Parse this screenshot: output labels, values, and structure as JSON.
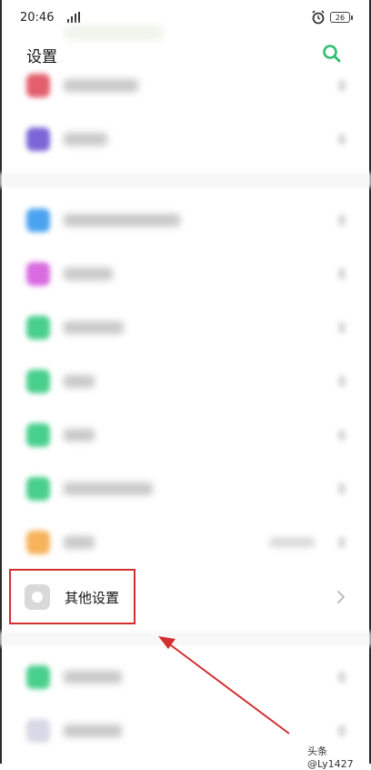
{
  "status_bar": {
    "time": "20:46",
    "battery": "26",
    "icons": [
      "signal-icon",
      "alarm-icon",
      "battery-icon"
    ]
  },
  "header": {
    "title": "设置",
    "search_icon": "search-icon"
  },
  "colors": {
    "accent": "#2fbf71",
    "highlight": "#d32f2f",
    "arrow": "#d32f2f"
  },
  "settings_list": {
    "highlighted_item": {
      "label": "其他设置",
      "icon": "settings-gear-icon"
    }
  },
  "watermark": "头条 @Ly1427"
}
